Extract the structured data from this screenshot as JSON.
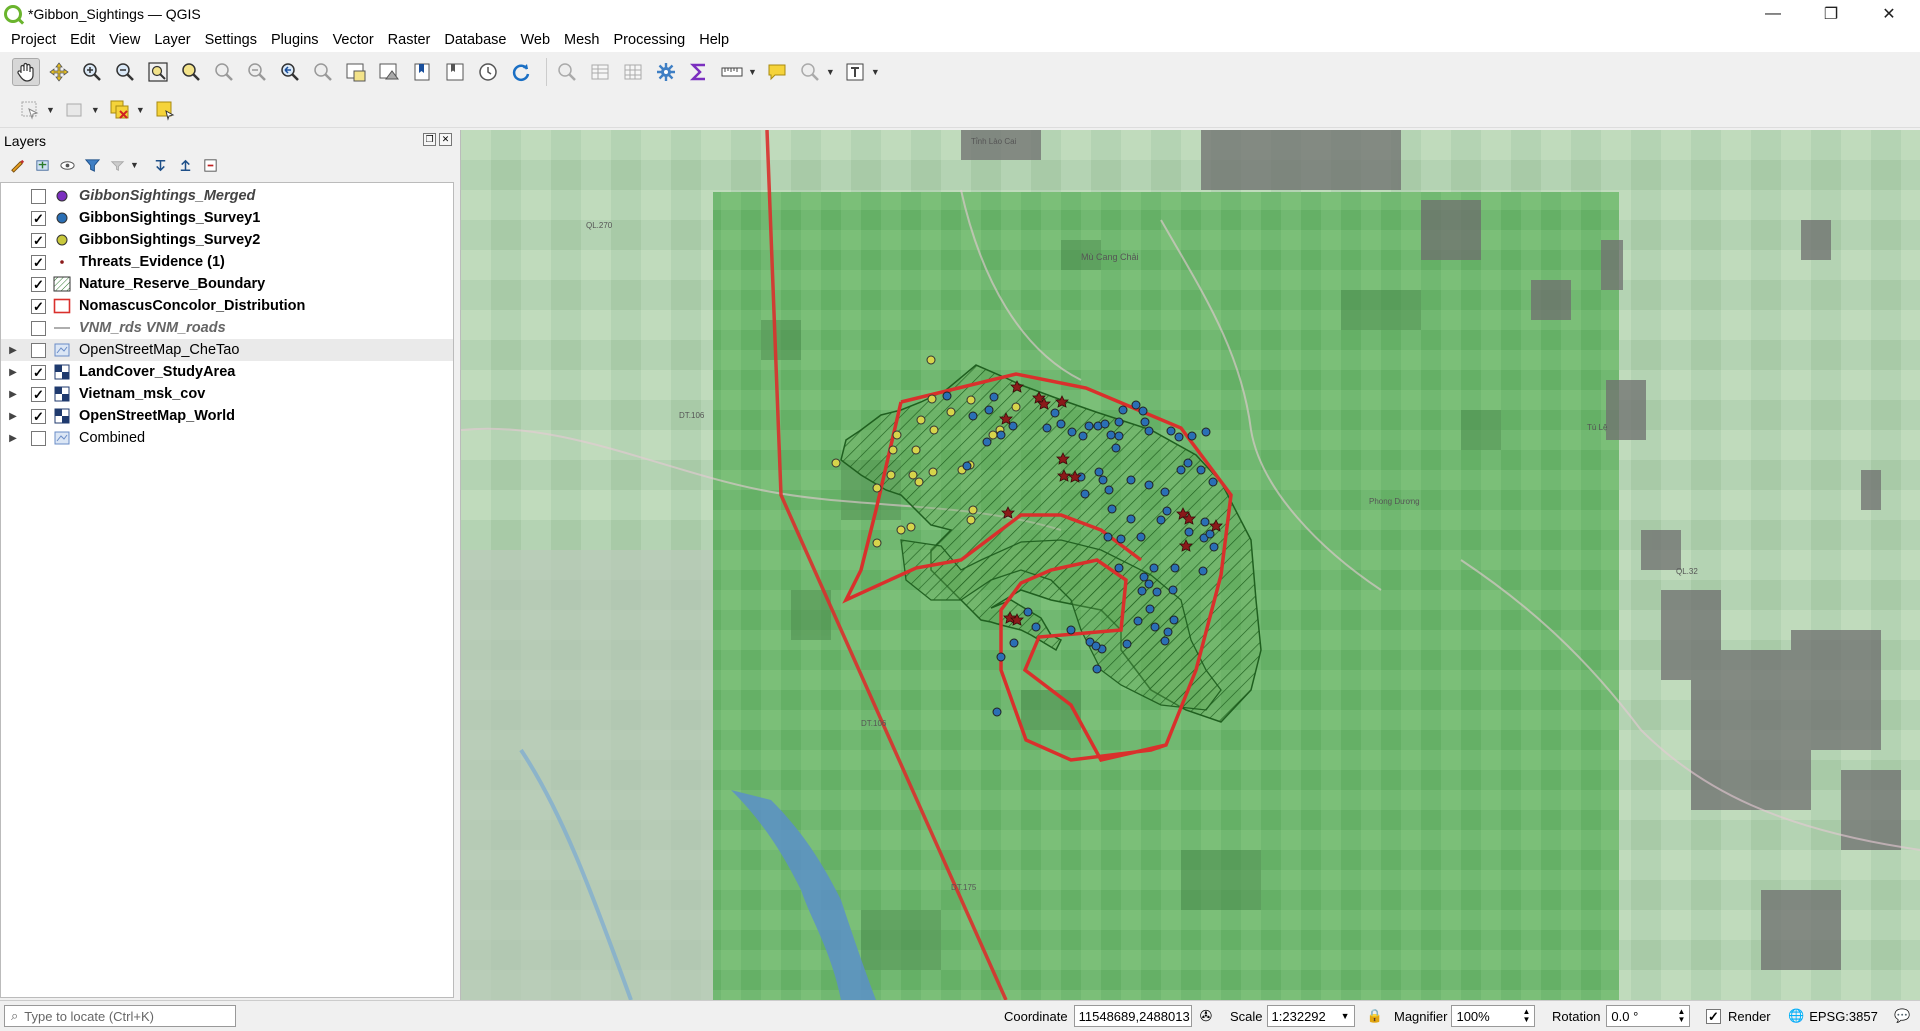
{
  "window": {
    "title": "*Gibbon_Sightings — QGIS",
    "minimize": "—",
    "restore": "❐",
    "close": "✕"
  },
  "menu": [
    "Project",
    "Edit",
    "View",
    "Layer",
    "Settings",
    "Plugins",
    "Vector",
    "Raster",
    "Database",
    "Web",
    "Mesh",
    "Processing",
    "Help"
  ],
  "layers_panel": {
    "title": "Layers",
    "layers": [
      {
        "name": "GibbonSightings_Merged",
        "checked": false,
        "style": "italic",
        "symbol": "point",
        "color": "#7b2fbf",
        "expandable": false
      },
      {
        "name": "GibbonSightings_Survey1",
        "checked": true,
        "style": "bold",
        "symbol": "point",
        "color": "#2a6fb5",
        "expandable": false
      },
      {
        "name": "GibbonSightings_Survey2",
        "checked": true,
        "style": "bold",
        "symbol": "point",
        "color": "#c8c83c",
        "expandable": false
      },
      {
        "name": "Threats_Evidence (1)",
        "checked": true,
        "style": "bold",
        "symbol": "star",
        "color": "#8b1a1a",
        "expandable": false
      },
      {
        "name": "Nature_Reserve_Boundary",
        "checked": true,
        "style": "bold",
        "symbol": "hatch",
        "color": "#2e8b2e",
        "expandable": false
      },
      {
        "name": "NomascusConcolor_Distribution",
        "checked": true,
        "style": "bold",
        "symbol": "outline",
        "color": "#d9302c",
        "expandable": false
      },
      {
        "name": "VNM_rds VNM_roads",
        "checked": false,
        "style": "italicplain",
        "symbol": "line",
        "color": "#999999",
        "expandable": false
      },
      {
        "name": "OpenStreetMap_CheTao",
        "checked": false,
        "style": "plain",
        "symbol": "raster",
        "color": "#6a8cc7",
        "expandable": true
      },
      {
        "name": "LandCover_StudyArea",
        "checked": true,
        "style": "bold",
        "symbol": "grid",
        "color": "#1f3a6e",
        "expandable": true
      },
      {
        "name": "Vietnam_msk_cov",
        "checked": true,
        "style": "bold",
        "symbol": "grid",
        "color": "#1f3a6e",
        "expandable": true
      },
      {
        "name": "OpenStreetMap_World",
        "checked": true,
        "style": "bold",
        "symbol": "grid",
        "color": "#1f3a6e",
        "expandable": true
      },
      {
        "name": "Combined",
        "checked": false,
        "style": "plain",
        "symbol": "raster",
        "color": "#6a8cc7",
        "expandable": true
      }
    ]
  },
  "map_labels": [
    "Tỉnh Lào Cai",
    "QL.270",
    "DT.106",
    "Mù Cang Chải",
    "DT.106",
    "QL.32",
    "Tú Lệ",
    "Phong Dương",
    "DT.175"
  ],
  "status": {
    "locate_placeholder": "Type to locate (Ctrl+K)",
    "coordinate_label": "Coordinate",
    "coordinate_value": "11548689,2488013",
    "scale_label": "Scale",
    "scale_value": "1:232292",
    "magnifier_label": "Magnifier",
    "magnifier_value": "100%",
    "rotation_label": "Rotation",
    "rotation_value": "0.0 °",
    "render_label": "Render",
    "render_checked": true,
    "crs": "EPSG:3857"
  }
}
